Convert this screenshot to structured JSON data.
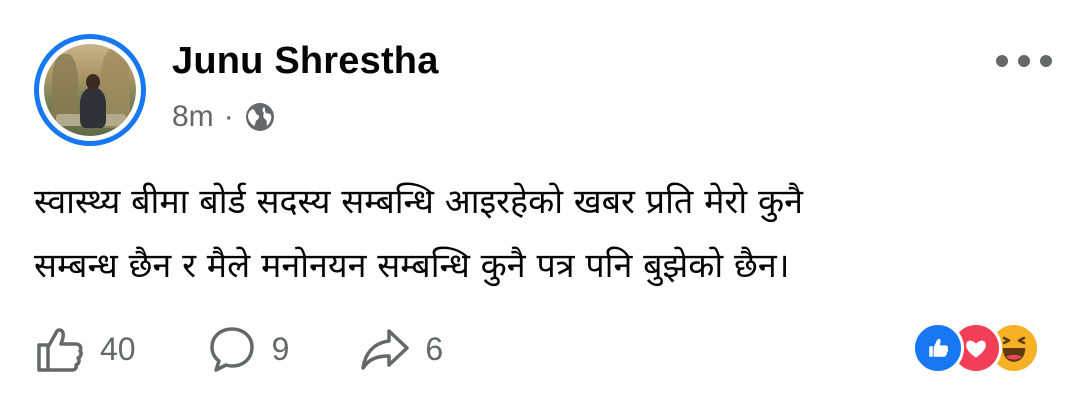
{
  "post": {
    "author": "Junu Shrestha",
    "time": "8m",
    "separator": "·",
    "privacy_icon": "globe-icon",
    "text_line1": "स्वास्थ्य बीमा बोर्ड सदस्य सम्बन्धि आइरहेको खबर प्रति मेरो कुनै",
    "text_line2": "सम्बन्ध छैन र मैले मनोनयन सम्बन्धि कुनै पत्र पनि बुझेको छैन।"
  },
  "actions": {
    "likes": "40",
    "comments": "9",
    "shares": "6"
  },
  "reactions": [
    "like-icon",
    "love-icon",
    "haha-icon"
  ],
  "colors": {
    "accent": "#1877f2",
    "secondary_text": "#65676b",
    "love": "#f33e58",
    "haha": "#f7b125"
  }
}
